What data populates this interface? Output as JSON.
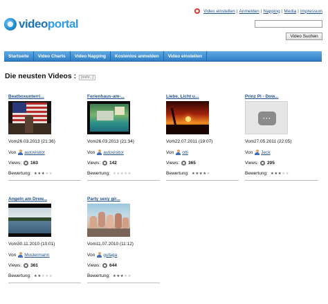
{
  "header": {
    "logo_part1": "video",
    "logo_part2": "portal",
    "topnav": [
      "Video einstellen",
      "Anmelden",
      "Napping",
      "Media",
      "Impressum"
    ],
    "topnav_separator": "|",
    "search": {
      "value": "",
      "placeholder": "",
      "button_label": "Video Suchen"
    }
  },
  "mainnav": {
    "tabs": [
      "Startseite",
      "Video Charts",
      "Video Napping",
      "Kostenlos anmelden",
      "Video einstellen"
    ]
  },
  "section": {
    "title": "Die neusten Videos :",
    "more_label": "[mehr...]"
  },
  "labels": {
    "von": "Von",
    "views": "Views:",
    "bewertung": "Bewertung:"
  },
  "videos": [
    {
      "title": "Beatboxunterri...",
      "date": "Vom26.03.2013 (21:36)",
      "user": "autovisitor",
      "views": "163",
      "rating": 3,
      "thumb": "flag"
    },
    {
      "title": "Ferienhaus-am-...",
      "date": "Vom26.03.2013 (21:34)",
      "user": "autovisitor",
      "views": "142",
      "rating": 0,
      "thumb": "pool"
    },
    {
      "title": "Liebe, Licht u...",
      "date": "Vom22.07.2011 (19:07)",
      "user": "otti",
      "views": "365",
      "rating": 4,
      "thumb": "sunset"
    },
    {
      "title": "Prinz Pi - Dow...",
      "date": "Vom27.05.2011 (22:05)",
      "user": "Jeck",
      "views": "205",
      "rating": 3,
      "thumb": "placeholder"
    },
    {
      "title": "Angeln am Drew...",
      "date": "Vom30.11.2010 (10:01)",
      "user": "Mustermann",
      "views": "361",
      "rating": 2,
      "thumb": "lake"
    },
    {
      "title": "Party sexy gir...",
      "date": "Vom11.07.2010 (11:12)",
      "user": "gufaga",
      "views": "644",
      "rating": 3,
      "thumb": "party"
    }
  ],
  "colors": {
    "link": "#1f4f8a",
    "nav_bar": "#2f7ec6",
    "logo_dark": "#1a73b8",
    "logo_light": "#2f9be0"
  }
}
